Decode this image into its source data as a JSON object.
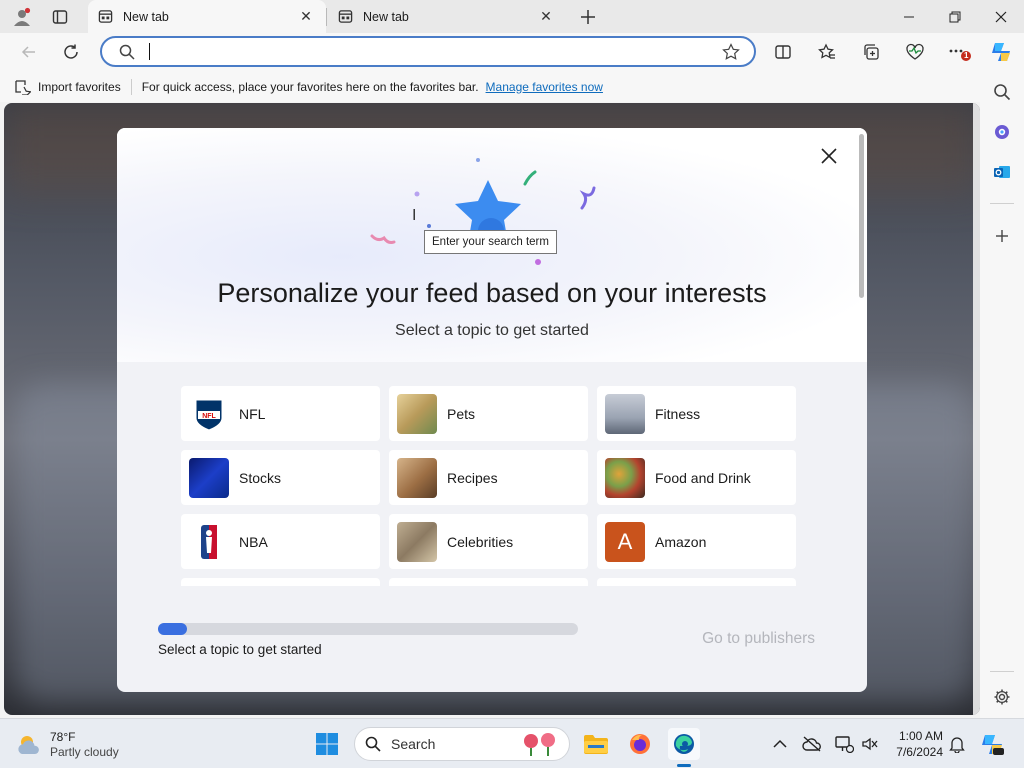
{
  "browser": {
    "tabs": [
      {
        "label": "New tab",
        "active": true
      },
      {
        "label": "New tab",
        "active": false
      }
    ],
    "window_controls": [
      "minimize",
      "restore",
      "close"
    ],
    "address_bar": {
      "value": "",
      "placeholder": ""
    },
    "notification_badge": "1"
  },
  "favorites_bar": {
    "import_label": "Import favorites",
    "message": "For quick access, place your favorites here on the favorites bar.",
    "manage_link": "Manage favorites now"
  },
  "modal": {
    "title": "Personalize your feed based on your interests",
    "subtitle": "Select a topic to get started",
    "topics": [
      {
        "label": "NFL",
        "icon": "nfl-logo"
      },
      {
        "label": "Pets",
        "icon": "pets-photo"
      },
      {
        "label": "Fitness",
        "icon": "fitness-photo"
      },
      {
        "label": "Stocks",
        "icon": "stocks-photo"
      },
      {
        "label": "Recipes",
        "icon": "recipes-photo"
      },
      {
        "label": "Food and Drink",
        "icon": "food-photo"
      },
      {
        "label": "NBA",
        "icon": "nba-logo"
      },
      {
        "label": "Celebrities",
        "icon": "celebrities-photo"
      },
      {
        "label": "Amazon",
        "icon": "amazon-letter",
        "letter": "A"
      }
    ],
    "progress_fraction": 0.07,
    "progress_text": "Select a topic to get started",
    "go_button": "Go to publishers",
    "tooltip": "Enter your search term"
  },
  "taskbar": {
    "weather": {
      "temp": "78°F",
      "condition": "Partly cloudy"
    },
    "search_label": "Search",
    "time": "1:00 AM",
    "date": "7/6/2024"
  },
  "colors": {
    "accent": "#0f6cbd",
    "address_border": "#4a7cc7",
    "progress_fill": "#3a6fe0",
    "amazon_tile": "#c9531c"
  }
}
